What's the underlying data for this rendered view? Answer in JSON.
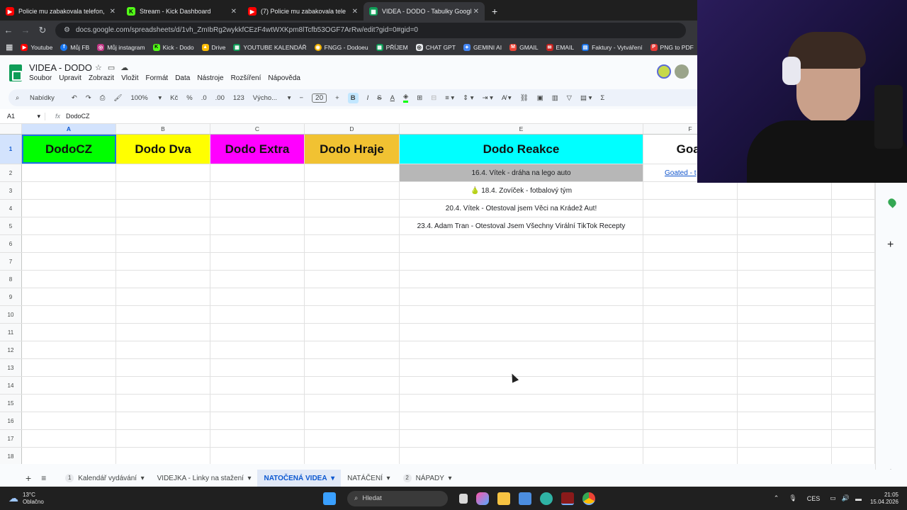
{
  "browser": {
    "tabs": [
      {
        "label": "Policie mu zabakovala telefon,",
        "icon": "youtube-icon",
        "color": "#ff0000",
        "active": false
      },
      {
        "label": "Stream - Kick Dashboard",
        "icon": "kick-icon",
        "color": "#53fc18",
        "active": false
      },
      {
        "label": "(7) Policie mu zabakovala tele",
        "icon": "youtube-icon",
        "color": "#ff0000",
        "active": false
      },
      {
        "label": "VIDEA - DODO - Tabulky Googl",
        "icon": "sheets-icon",
        "color": "#0f9d58",
        "active": true
      }
    ],
    "url": "docs.google.com/spreadsheets/d/1vh_ZmIbRg2wykkfCEzF4wtWXKpm8lTcfb53OGF7ArRw/edit?gid=0#gid=0",
    "bookmarks": [
      {
        "label": "Youtube",
        "color": "#ff0000"
      },
      {
        "label": "Můj FB",
        "color": "#1877f2"
      },
      {
        "label": "Můj instagram",
        "color": "#c13584"
      },
      {
        "label": "Kick - Dodo",
        "color": "#53fc18"
      },
      {
        "label": "Drive",
        "color": "#fbbc04"
      },
      {
        "label": "YOUTUBE KALENDÁŘ",
        "color": "#0f9d58"
      },
      {
        "label": "FNGG - Dodoeu",
        "color": "#f4b400"
      },
      {
        "label": "PŘÍJEM",
        "color": "#0f9d58"
      },
      {
        "label": "CHAT GPT",
        "color": "#e8eaed"
      },
      {
        "label": "GEMINI AI",
        "color": "#4285f4"
      },
      {
        "label": "GMAIL",
        "color": "#ea4335"
      },
      {
        "label": "EMAIL",
        "color": "#c5221f"
      },
      {
        "label": "Faktury - Vytváření",
        "color": "#1a73e8"
      },
      {
        "label": "PNG to PDF",
        "color": "#e53935"
      }
    ]
  },
  "doc": {
    "title": "VIDEA - DODO",
    "menu": [
      "Soubor",
      "Upravit",
      "Zobrazit",
      "Vložit",
      "Formát",
      "Data",
      "Nástroje",
      "Rozšíření",
      "Nápověda"
    ],
    "toolbar": {
      "search": "Nabídky",
      "zoom": "100%",
      "currency": "Kč",
      "percent": "%",
      "dec_less": ".0",
      "dec_more": ".00",
      "format123": "123",
      "font": "Výcho...",
      "font_size": "20",
      "bold": "B",
      "italic": "I",
      "strike": "S",
      "textcolor": "A",
      "sigma": "Σ"
    },
    "cell_ref": "A1",
    "formula": "DodoCZ"
  },
  "grid": {
    "columns": [
      "A",
      "B",
      "C",
      "D",
      "E",
      "F"
    ],
    "headers": [
      {
        "text": "DodoCZ",
        "bg": "#00ff00"
      },
      {
        "text": "Dodo Dva",
        "bg": "#ffff00"
      },
      {
        "text": "Dodo Extra",
        "bg": "#ff00ff"
      },
      {
        "text": "Dodo Hraje",
        "bg": "#f1c232"
      },
      {
        "text": "Dodo Reakce",
        "bg": "#00ffff"
      },
      {
        "text": "Goat",
        "bg": "#ffffff"
      }
    ],
    "row_numbers": [
      "1",
      "2",
      "3",
      "4",
      "5",
      "6",
      "7",
      "8",
      "9",
      "10",
      "11",
      "12",
      "13",
      "14",
      "15",
      "16",
      "17",
      "18"
    ],
    "e_entries": [
      "16.4. Vítek - dráha na lego auto",
      "🍐 18.4. Zovíček - fotbalový tým",
      "20.4. Vítek - Otestoval jsem Věci na Krádež Aut!",
      "23.4. Adam Tran - Otestoval Jsem Všechny Virální TikTok Recepty"
    ],
    "f2_link": "Goated - t"
  },
  "sheet_tabs": [
    {
      "num": "1",
      "label": "Kalendář vydávání",
      "active": false
    },
    {
      "num": "",
      "label": "VIDEJKA - Linky na stažení",
      "active": false
    },
    {
      "num": "",
      "label": "NATOČENÁ VIDEA",
      "active": true
    },
    {
      "num": "",
      "label": "NATÁČENÍ",
      "active": false
    },
    {
      "num": "2",
      "label": "NÁPADY",
      "active": false
    }
  ],
  "taskbar": {
    "temp": "13°C",
    "weather": "Oblačno",
    "search": "Hledat",
    "lang": "CES",
    "time": "21:05",
    "date": "15.04.2026"
  }
}
